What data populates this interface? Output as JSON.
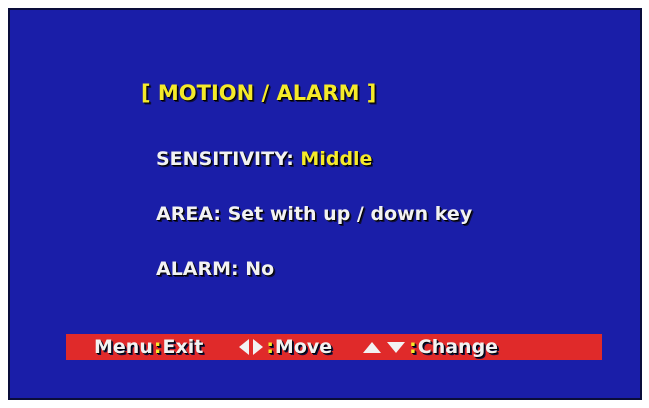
{
  "colors": {
    "background": "#1a1ea8",
    "accent_yellow": "#f5ea2a",
    "hint_bar_red": "#e02a2a",
    "text_white": "#f2f2f2"
  },
  "menu": {
    "title": "[ MOTION / ALARM ]",
    "sensitivity": {
      "label": "SENSITIVITY:",
      "value": "Middle"
    },
    "area": {
      "label": "AREA:",
      "value": "Set with up / down key"
    },
    "alarm": {
      "label": "ALARM:",
      "value": "No"
    }
  },
  "hints": {
    "menu_key": "Menu",
    "menu_action": "Exit",
    "move_action": "Move",
    "change_action": "Change",
    "separator": ":",
    "icons": [
      "arrow-left-icon",
      "arrow-right-icon",
      "arrow-up-icon",
      "arrow-down-icon"
    ]
  }
}
